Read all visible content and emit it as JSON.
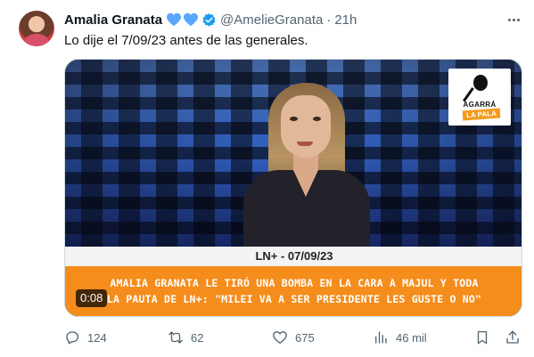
{
  "author": {
    "display_name": "Amalia Granata",
    "handle": "@AmelieGranata",
    "separator": "·",
    "time": "21h",
    "badges": [
      "blue-heart-icon",
      "blue-heart-icon",
      "verified-badge-icon"
    ]
  },
  "tweet": {
    "text": "Lo dije el 7/09/23 antes de las generales."
  },
  "media": {
    "logo_line1": "AGARRÁ",
    "logo_line2": "LA PALA",
    "date_bar": "LN+ - 07/09/23",
    "headline_line1": "AMALIA GRANATA LE TIRÓ UNA BOMBA EN LA CARA A MAJUL Y TODA",
    "headline_line2": "LA PAUTA DE LN+: \"MILEI VA A SER PRESIDENTE LES GUSTE O NO\"",
    "duration": "0:08"
  },
  "actions": {
    "replies": "124",
    "reposts": "62",
    "likes": "675",
    "views": "46 mil"
  },
  "colors": {
    "text": "#0f1419",
    "secondary": "#536471",
    "verified": "#1d9bf0",
    "heart": "#5aa7ff",
    "headline_orange": "#f58d1c"
  }
}
